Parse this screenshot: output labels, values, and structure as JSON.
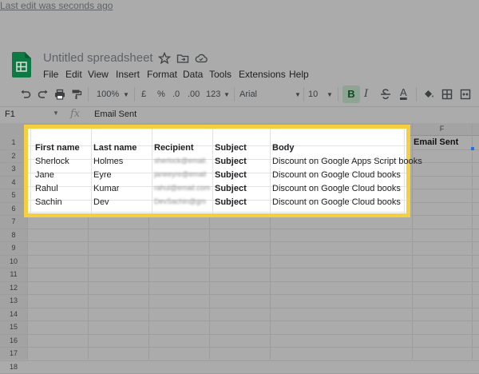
{
  "app": {
    "title": "Untitled spreadsheet",
    "last_edit": "Last edit was seconds ago",
    "menu": [
      "File",
      "Edit",
      "View",
      "Insert",
      "Format",
      "Data",
      "Tools",
      "Extensions",
      "Help"
    ],
    "title_icons": [
      "star-icon",
      "move-to-folder-icon",
      "cloud-status-icon"
    ],
    "brand_color": "#0f9d58"
  },
  "toolbar": {
    "zoom": "100%",
    "currency": "£",
    "percent": "%",
    "decrease_decimal": ".0",
    "increase_decimal": ".00",
    "more_formats": "123",
    "font": "Arial",
    "font_size": "10",
    "bold": "B",
    "text_color_letter": "A",
    "icons": [
      "undo-icon",
      "redo-icon",
      "print-icon",
      "paint-format-icon",
      "strikethrough-icon",
      "fill-color-icon",
      "borders-icon",
      "merge-cells-icon"
    ]
  },
  "formula_bar": {
    "cell_ref": "F1",
    "fx": "fx",
    "value": "Email Sent"
  },
  "grid": {
    "row_numbers": [
      "1",
      "2",
      "3",
      "4",
      "5",
      "6",
      "7",
      "8",
      "9",
      "10",
      "11",
      "12",
      "13",
      "14",
      "15",
      "16",
      "17",
      "18"
    ],
    "visible_column_letter": "F",
    "f1_value": "Email Sent"
  },
  "table": {
    "headers": [
      "First name",
      "Last name",
      "Recipient",
      "Subject",
      "Body"
    ],
    "rows": [
      [
        "Sherlock",
        "Holmes",
        "sherlock@email.",
        "Subject",
        "Discount on Google Apps Script books"
      ],
      [
        "Jane",
        "Eyre",
        "janeeyre@email",
        "Subject",
        "Discount on Google Cloud books"
      ],
      [
        "Rahul",
        "Kumar",
        "rahul@email.com",
        "Subject",
        "Discount on Google Cloud books"
      ],
      [
        "Sachin",
        "Dev",
        "DevSachin@gm",
        "Subject",
        "Discount on Google Cloud books"
      ]
    ],
    "highlight_color": "#f4cf3f"
  }
}
